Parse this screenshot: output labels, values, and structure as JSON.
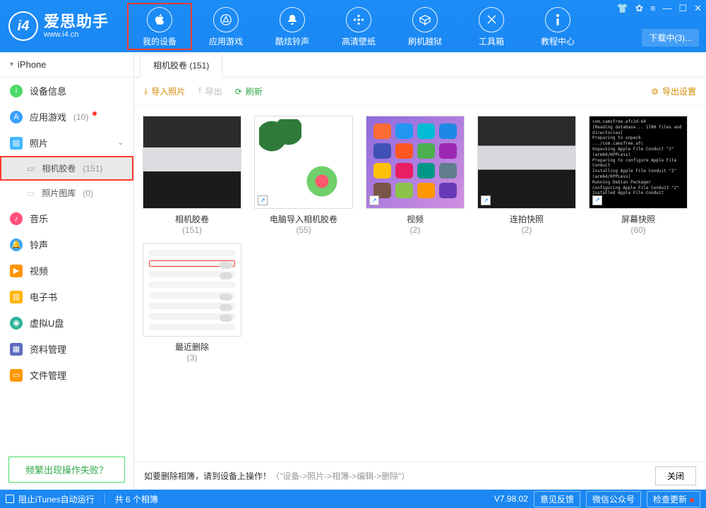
{
  "app": {
    "name_cn": "爱思助手",
    "site": "www.i4.cn"
  },
  "nav": [
    {
      "label": "我的设备"
    },
    {
      "label": "应用游戏"
    },
    {
      "label": "酷炫铃声"
    },
    {
      "label": "高清壁纸"
    },
    {
      "label": "刷机越狱"
    },
    {
      "label": "工具箱"
    },
    {
      "label": "教程中心"
    }
  ],
  "download_btn": "下载中(3)...",
  "device_selector": "iPhone",
  "sidebar": {
    "items": [
      {
        "label": "设备信息"
      },
      {
        "label": "应用游戏",
        "count": "(10)"
      },
      {
        "label": "照片"
      },
      {
        "label": "相机胶卷",
        "count": "(151)"
      },
      {
        "label": "照片图库",
        "count": "(0)"
      },
      {
        "label": "音乐"
      },
      {
        "label": "铃声"
      },
      {
        "label": "视频"
      },
      {
        "label": "电子书"
      },
      {
        "label": "虚拟U盘"
      },
      {
        "label": "资料管理"
      },
      {
        "label": "文件管理"
      }
    ],
    "faq": "频繁出现操作失败？"
  },
  "tab": {
    "title": "相机胶卷 (151)"
  },
  "toolbar": {
    "import": "导入照片",
    "export": "导出",
    "refresh": "刷新",
    "settings": "导出设置"
  },
  "albums": [
    {
      "name": "相机胶卷",
      "count": "(151)"
    },
    {
      "name": "电脑导入相机胶卷",
      "count": "(55)"
    },
    {
      "name": "视频",
      "count": "(2)"
    },
    {
      "name": "连拍快照",
      "count": "(2)"
    },
    {
      "name": "屏幕快照",
      "count": "(60)"
    },
    {
      "name": "最近删除",
      "count": "(3)"
    }
  ],
  "tip": {
    "text": "如要删除相簿，请到设备上操作！",
    "path": "（\"设备->照片->相簿->编辑->删除\"）",
    "close": "关闭"
  },
  "status": {
    "itunes_block": "阻止iTunes自动运行",
    "album_count": "共 6 个相簿",
    "version": "V7.98.02",
    "feedback": "意见反馈",
    "wechat": "微信公众号",
    "check_update": "检查更新"
  }
}
